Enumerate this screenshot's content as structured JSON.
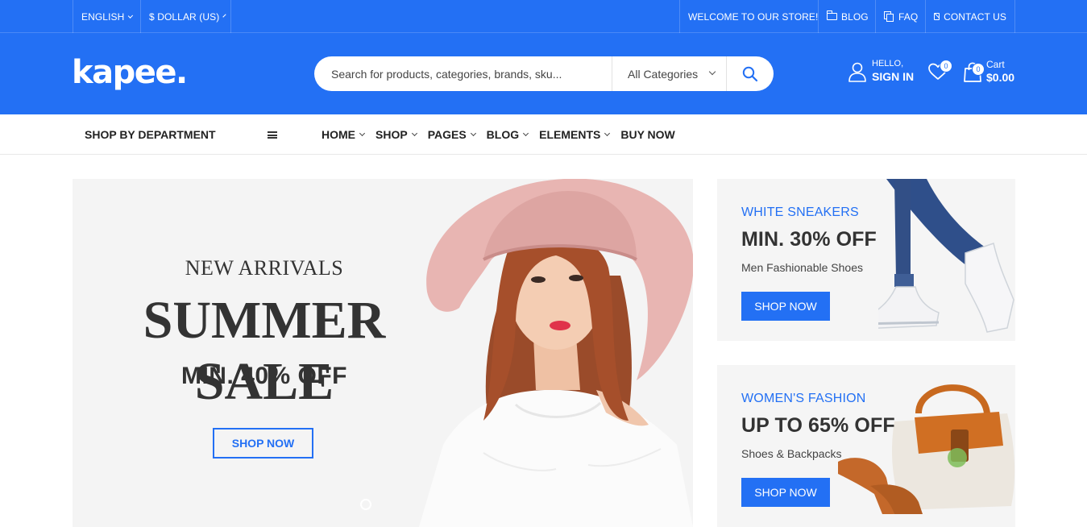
{
  "topbar": {
    "language": "ENGLISH",
    "currency": "$ DOLLAR (US)",
    "welcome": "WELCOME TO OUR STORE!",
    "blog": "BLOG",
    "faq": "FAQ",
    "contact": "CONTACT US"
  },
  "header": {
    "logo": "kapee.",
    "search_placeholder": "Search for products, categories, brands, sku...",
    "category": "All Categories",
    "account_greeting": "HELLO,",
    "account_action": "SIGN IN",
    "wishlist_count": "0",
    "cart_count": "0",
    "cart_label": "Cart",
    "cart_total": "$0.00"
  },
  "nav": {
    "department": "SHOP BY DEPARTMENT",
    "items": [
      "HOME",
      "SHOP",
      "PAGES",
      "BLOG",
      "ELEMENTS",
      "BUY NOW"
    ]
  },
  "hero": {
    "subtitle": "NEW ARRIVALS",
    "title": "SUMMER SALE",
    "offer": "MIN. 40% OFF",
    "button": "SHOP NOW"
  },
  "promos": [
    {
      "tag": "WHITE SNEAKERS",
      "headline": "MIN. 30% OFF",
      "description": "Men Fashionable Shoes",
      "button": "SHOP NOW"
    },
    {
      "tag": "WOMEN'S FASHION",
      "headline": "UP TO 65% OFF",
      "description": "Shoes & Backpacks",
      "button": "SHOP NOW"
    }
  ],
  "colors": {
    "brand": "#2370F4",
    "text_dark": "#333333",
    "panel": "#F5F5F5"
  }
}
